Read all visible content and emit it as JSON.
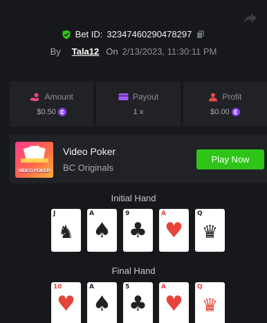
{
  "bet": {
    "label": "Bet ID:",
    "id": "32347460290478297",
    "by_label": "By",
    "user": "Tala12",
    "on_label": "On",
    "date": "2/13/2023, 11:30:11 PM"
  },
  "stats": [
    {
      "name": "amount",
      "label": "Amount",
      "value": "$0.50",
      "icon": "money-hand-icon"
    },
    {
      "name": "payout",
      "label": "Payout",
      "value": "1 x",
      "icon": "wallet-icon"
    },
    {
      "name": "profit",
      "label": "Profit",
      "value": "$0.00",
      "icon": "profit-user-icon"
    }
  ],
  "game": {
    "name": "Video Poker",
    "provider": "BC Originals",
    "thumb_text": "VIDEO POKER",
    "play_label": "Play Now"
  },
  "initial_hand": {
    "label": "Initial Hand",
    "cards": [
      {
        "rank": "J",
        "suit": "spades",
        "color": "black",
        "face": true
      },
      {
        "rank": "A",
        "suit": "spades",
        "color": "black",
        "face": false
      },
      {
        "rank": "9",
        "suit": "clubs",
        "color": "black",
        "face": false
      },
      {
        "rank": "A",
        "suit": "hearts",
        "color": "red",
        "face": false
      },
      {
        "rank": "Q",
        "suit": "spades",
        "color": "black",
        "face": true
      }
    ]
  },
  "final_hand": {
    "label": "Final Hand",
    "cards": [
      {
        "rank": "10",
        "suit": "hearts",
        "color": "red",
        "face": false
      },
      {
        "rank": "A",
        "suit": "spades",
        "color": "black",
        "face": false
      },
      {
        "rank": "5",
        "suit": "clubs",
        "color": "black",
        "face": false
      },
      {
        "rank": "A",
        "suit": "hearts",
        "color": "red",
        "face": false
      },
      {
        "rank": "Q",
        "suit": "hearts",
        "color": "red",
        "face": true
      }
    ]
  },
  "colors": {
    "background": "#17181b",
    "panel": "#202226",
    "accent_green": "#2ec418",
    "coin_purple": "#8a3ff6",
    "stat_icon_pink": "#f0447a",
    "stat_icon_purple": "#a35bf5",
    "stat_icon_red": "#ee4a4a"
  }
}
